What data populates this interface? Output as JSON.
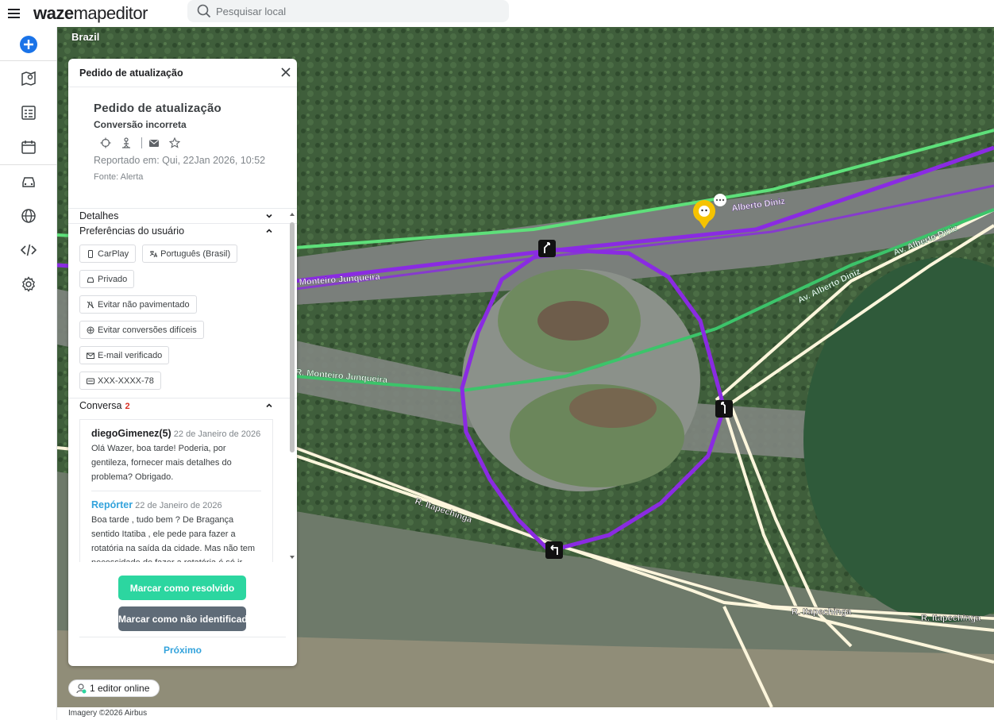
{
  "app": {
    "logo_bold": "waze",
    "logo_rest": "mapeditor"
  },
  "search": {
    "placeholder": "Pesquisar local"
  },
  "sidebar": {
    "items": [
      {
        "icon": "plus-circle-icon",
        "color": "#1a73e8"
      },
      {
        "icon": "map-layers-icon"
      },
      {
        "icon": "issues-list-icon"
      },
      {
        "icon": "events-calendar-icon"
      },
      {
        "icon": "car-icon"
      },
      {
        "icon": "globe-icon"
      },
      {
        "icon": "code-icon"
      },
      {
        "icon": "settings-gear-icon"
      }
    ]
  },
  "map": {
    "country": "Brazil",
    "attribution": "Imagery ©2026 Airbus",
    "street_labels": [
      "Av. Alberto Diniz",
      "Av. Alberto Diniz",
      "R. Monteiro Junqueira",
      "R. Itapechinga",
      "R. Itapechinga",
      "R. Itapechinga",
      "Alberto Diniz",
      "Monteiro Junqueira"
    ],
    "colors": {
      "primary_route": "#8a2be2",
      "street_green": "#5ee07a",
      "street_beige": "#fdf6dc"
    }
  },
  "online": {
    "text": "1 editor online"
  },
  "panel": {
    "header": "Pedido de atualização",
    "title": "Pedido de atualização",
    "subtitle": "Conversão incorreta",
    "reported": "Reportado em: Qui, 22Jan 2026, 10:52",
    "source": "Fonte: Alerta",
    "sections": {
      "details": "Detalhes",
      "preferences": "Preferências do usuário",
      "conversation": "Conversa",
      "conversation_count": "2"
    },
    "preferences": [
      {
        "icon": "phone-icon",
        "label": "CarPlay"
      },
      {
        "icon": "translate-icon",
        "label": "Português (Brasil)"
      },
      {
        "icon": "car-small-icon",
        "label": "Privado"
      },
      {
        "icon": "unpaved-icon",
        "label": "Evitar não pavimentado"
      },
      {
        "icon": "difficult-turn-icon",
        "label": "Evitar conversões difíceis"
      },
      {
        "icon": "email-icon",
        "label": "E-mail verificado"
      },
      {
        "icon": "card-icon",
        "label": "XXX-XXXX-78"
      }
    ],
    "messages": [
      {
        "author": "diegoGimenez(5)",
        "date": "22 de Janeiro de 2026",
        "text": "Olá Wazer, boa tarde! Poderia, por gentileza, fornecer mais detalhes do problema? Obrigado."
      },
      {
        "author": "Repórter",
        "date": "22 de Janeiro de 2026",
        "text": "Boa tarde , tudo bem ? De Bragança sentido Itatiba , ele pede para fazer a rotatória na saída da cidade. Mas não tem necessidade de fazer a rotatória é só ir reto."
      }
    ],
    "actions": {
      "resolve": "Marcar como resolvido",
      "not_identified": "Marcar como não identificado",
      "next": "Próximo"
    }
  }
}
